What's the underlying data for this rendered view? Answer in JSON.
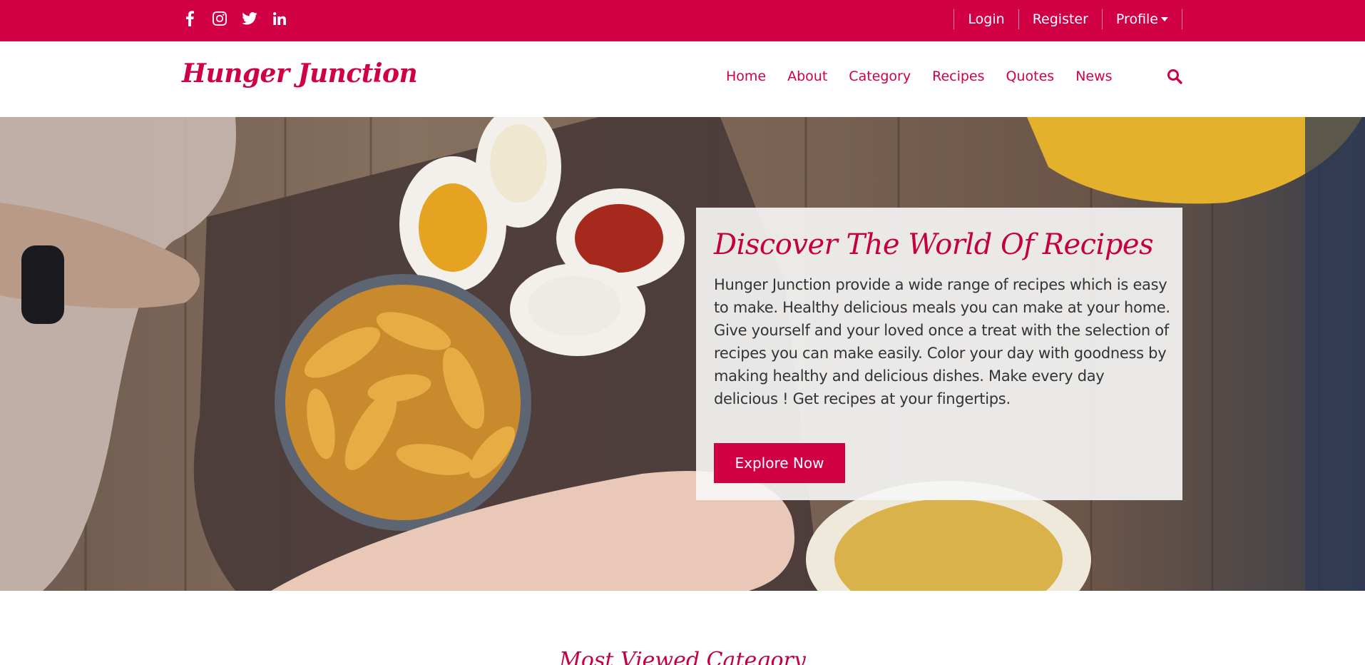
{
  "topbar": {
    "social": [
      {
        "icon": "facebook-icon"
      },
      {
        "icon": "instagram-icon"
      },
      {
        "icon": "twitter-icon"
      },
      {
        "icon": "linkedin-icon"
      }
    ],
    "login_label": "Login",
    "register_label": "Register",
    "profile_label": "Profile"
  },
  "navbar": {
    "brand": "Hunger Junction",
    "links": [
      "Home",
      "About",
      "Category",
      "Recipes",
      "Quotes",
      "News"
    ],
    "search_icon": "search-icon"
  },
  "hero": {
    "title": "Discover The World Of Recipes",
    "text": "Hunger Junction provide a wide range of recipes which is easy to make. Healthy delicious meals you can make at your home. Give yourself and your loved once a treat with the selection of recipes you can make easily. Color your day with goodness by making healthy and delicious dishes. Make every day delicious ! Get recipes at your fingertips.",
    "button_label": "Explore Now"
  },
  "section": {
    "heading": "Most Viewed Category"
  },
  "colors": {
    "brand": "#d10045",
    "white": "#ffffff"
  }
}
